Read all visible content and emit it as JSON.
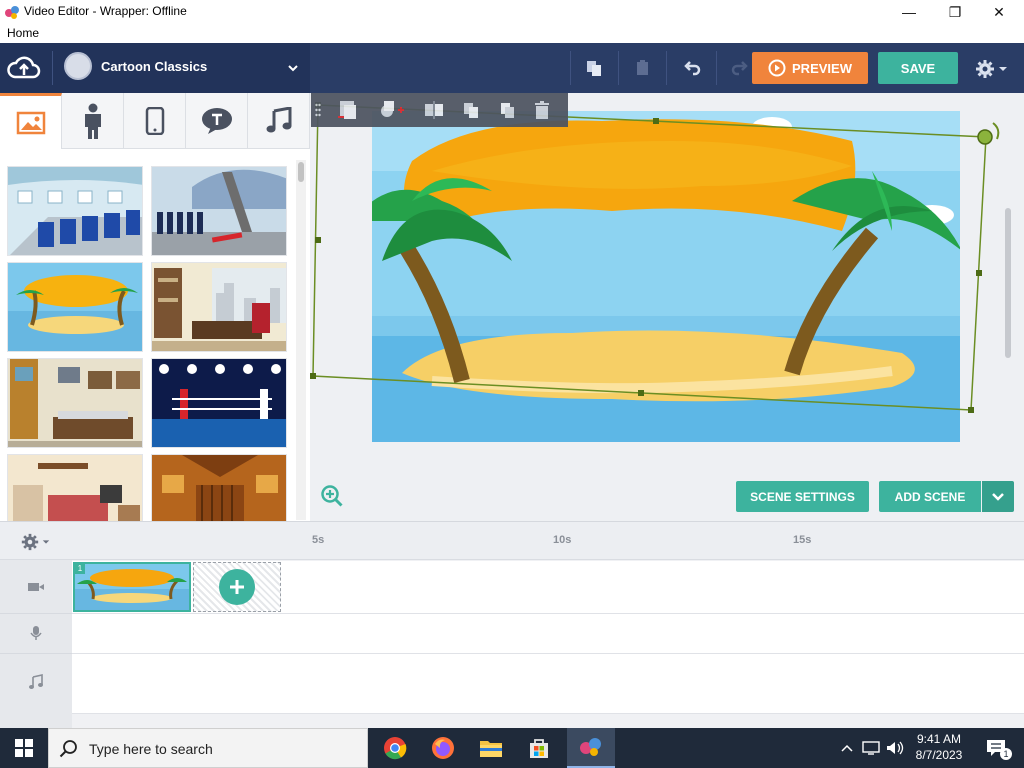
{
  "window": {
    "title": "Video Editor - Wrapper: Offline",
    "menu_home": "Home",
    "minimize": "—",
    "maximize": "❐",
    "close": "✕"
  },
  "header": {
    "theme_name": "Cartoon Classics",
    "preview_label": "PREVIEW",
    "save_label": "SAVE"
  },
  "asset_tabs": [
    {
      "icon": "image-icon",
      "active": true
    },
    {
      "icon": "character-icon"
    },
    {
      "icon": "phone-icon"
    },
    {
      "icon": "speech-bubble-icon"
    },
    {
      "icon": "music-note-icon"
    }
  ],
  "stage": {
    "scene_settings_label": "SCENE SETTINGS",
    "add_scene_label": "ADD SCENE"
  },
  "timeline": {
    "ticks": [
      "5s",
      "10s",
      "15s"
    ],
    "scene_number": "1"
  },
  "taskbar": {
    "search_placeholder": "Type here to search",
    "time": "9:41 AM",
    "date": "8/7/2023",
    "notification_count": "1"
  },
  "colors": {
    "header_bg": "#2a3d66",
    "accent_orange": "#f0843c",
    "accent_teal": "#3db39e"
  }
}
